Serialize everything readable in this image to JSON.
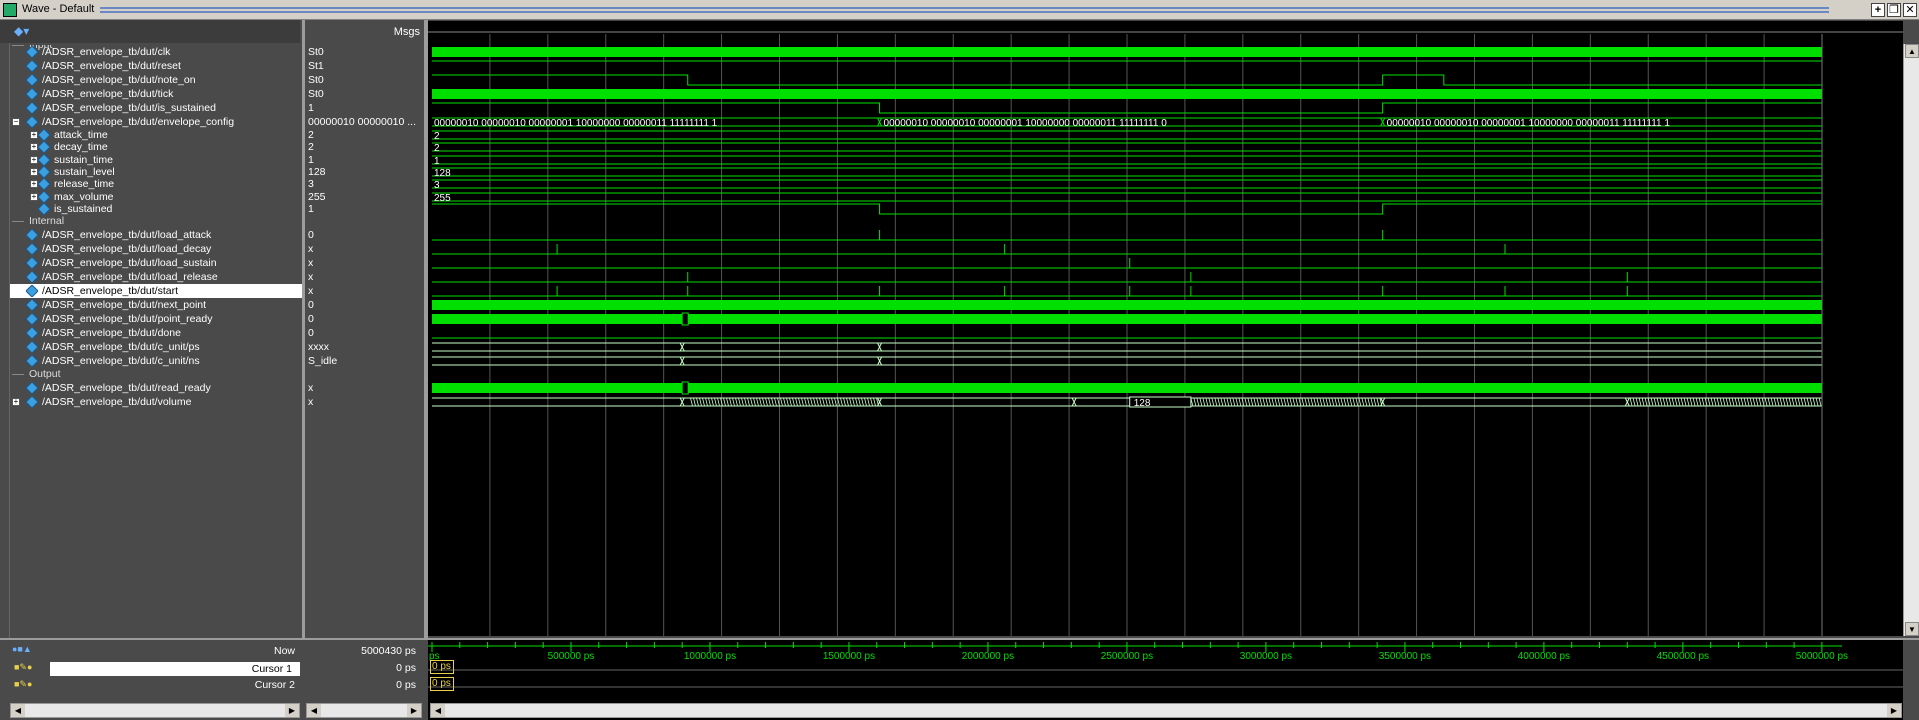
{
  "window": {
    "title": "Wave - Default",
    "buttons": [
      "+",
      "❐",
      "✕"
    ]
  },
  "header": {
    "msgs_label": "Msgs"
  },
  "groups": {
    "input": "Input",
    "internal": "Internal",
    "output": "Output"
  },
  "signals": [
    {
      "name": "/ADSR_envelope_tb/dut/clk",
      "value": "St0"
    },
    {
      "name": "/ADSR_envelope_tb/dut/reset",
      "value": "St1"
    },
    {
      "name": "/ADSR_envelope_tb/dut/note_on",
      "value": "St0"
    },
    {
      "name": "/ADSR_envelope_tb/dut/tick",
      "value": "St0"
    },
    {
      "name": "/ADSR_envelope_tb/dut/is_sustained",
      "value": "1"
    },
    {
      "name": "/ADSR_envelope_tb/dut/envelope_config",
      "value": "00000010 00000010 ..."
    },
    {
      "name": "attack_time",
      "value": "2"
    },
    {
      "name": "decay_time",
      "value": "2"
    },
    {
      "name": "sustain_time",
      "value": "1"
    },
    {
      "name": "sustain_level",
      "value": "128"
    },
    {
      "name": "release_time",
      "value": "3"
    },
    {
      "name": "max_volume",
      "value": "255"
    },
    {
      "name": "is_sustained",
      "value": "1"
    },
    {
      "name": "/ADSR_envelope_tb/dut/load_attack",
      "value": "0"
    },
    {
      "name": "/ADSR_envelope_tb/dut/load_decay",
      "value": "x"
    },
    {
      "name": "/ADSR_envelope_tb/dut/load_sustain",
      "value": "x"
    },
    {
      "name": "/ADSR_envelope_tb/dut/load_release",
      "value": "x"
    },
    {
      "name": "/ADSR_envelope_tb/dut/start",
      "value": "x"
    },
    {
      "name": "/ADSR_envelope_tb/dut/next_point",
      "value": "0"
    },
    {
      "name": "/ADSR_envelope_tb/dut/point_ready",
      "value": "0"
    },
    {
      "name": "/ADSR_envelope_tb/dut/done",
      "value": "0"
    },
    {
      "name": "/ADSR_envelope_tb/dut/c_unit/ps",
      "value": "xxxx"
    },
    {
      "name": "/ADSR_envelope_tb/dut/c_unit/ns",
      "value": "S_idle"
    },
    {
      "name": "/ADSR_envelope_tb/dut/read_ready",
      "value": "x"
    },
    {
      "name": "/ADSR_envelope_tb/dut/volume",
      "value": "x"
    }
  ],
  "wave_labels": {
    "config_a": "00000010 00000010 00000001 10000000 00000011 11111111 1",
    "config_b": "00000010 00000010 00000001 10000000 00000011 11111111 0",
    "config_c": "00000010 00000010 00000001 10000000 00000011 11111111 1",
    "attack": "2",
    "decay": "2",
    "sustain_time": "1",
    "sustain_level": "128",
    "release": "3",
    "max_volume": "255",
    "volume_marker": "128"
  },
  "bottom": {
    "now_label": "Now",
    "now_value": "5000430 ps",
    "cursor1_label": "Cursor 1",
    "cursor1_value": "0 ps",
    "cursor2_label": "Cursor 2",
    "cursor2_value": "0 ps",
    "cursor1_flag": "0 ps",
    "cursor2_flag": "0 ps",
    "time_start": "ps",
    "ticks": [
      "500000 ps",
      "1000000 ps",
      "1500000 ps",
      "2000000 ps",
      "2500000 ps",
      "3000000 ps",
      "3500000 ps",
      "4000000 ps",
      "4500000 ps",
      "5000000 ps"
    ]
  },
  "colors": {
    "wave_green": "#00e000",
    "bus_green": "#c8ffc8",
    "cursor_yellow": "#e8d04a",
    "background": "#000000"
  },
  "icons": {
    "signal": "signal-diamond-icon",
    "expand": "plus-box-icon",
    "collapse": "minus-box-icon"
  }
}
